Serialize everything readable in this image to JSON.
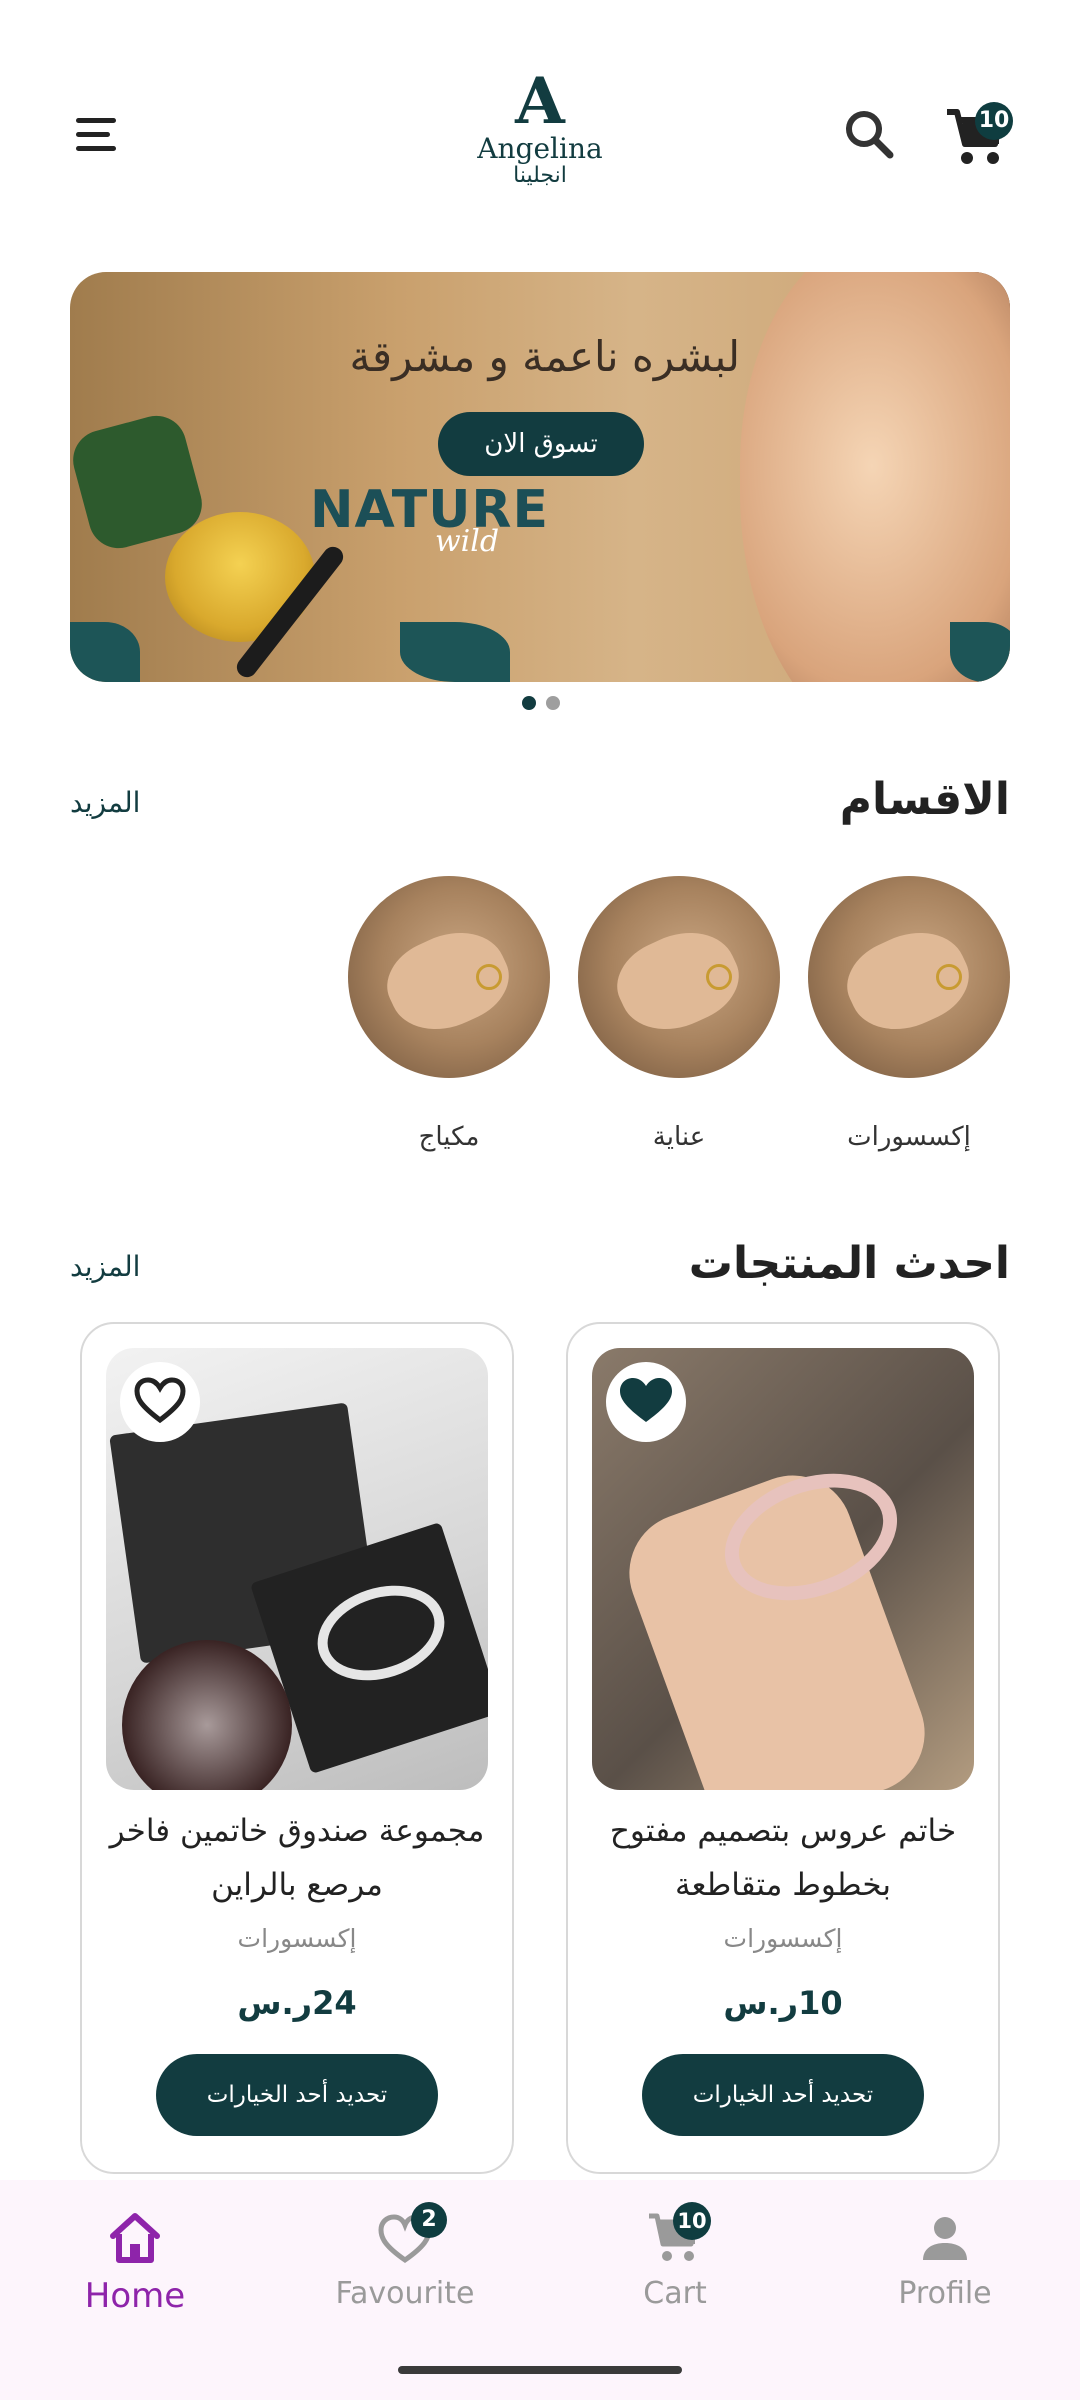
{
  "header": {
    "logo_en": "Angelina",
    "logo_ar": "انجلينا",
    "cart_count": "10"
  },
  "banner": {
    "title": "لبشره ناعمة و مشرقة",
    "cta_label": "تسوق الان",
    "brand_word": "NATURE",
    "brand_sub": "wild",
    "slide_count": 2,
    "active_slide": 1
  },
  "categories_section": {
    "title": "الاقسام",
    "more_label": "المزيد",
    "items": [
      {
        "label": "إكسسورات"
      },
      {
        "label": "عناية"
      },
      {
        "label": "مكياج"
      }
    ]
  },
  "products_section": {
    "title": "احدث المنتجات",
    "more_label": "المزيد",
    "items": [
      {
        "name": "خاتم عروس بتصميم مفتوح بخطوط متقاطعة",
        "category": "إكسسورات",
        "price": "10ر.س",
        "button_label": "تحديد أحد الخيارات",
        "favourited": true
      },
      {
        "name": "مجموعة صندوق خاتمين فاخر مرصع بالراين",
        "category": "إكسسورات",
        "price": "24ر.س",
        "button_label": "تحديد أحد الخيارات",
        "favourited": false
      }
    ]
  },
  "bottom_nav": {
    "items": [
      {
        "label": "Home",
        "icon": "home-icon",
        "active": true
      },
      {
        "label": "Favourite",
        "icon": "heart-icon",
        "badge": "2"
      },
      {
        "label": "Cart",
        "icon": "cart-icon",
        "badge": "10"
      },
      {
        "label": "Profile",
        "icon": "person-icon"
      }
    ]
  },
  "colors": {
    "brand_dark": "#123c40",
    "active_nav": "#8e24aa",
    "nav_bg": "#fdf5fc"
  }
}
